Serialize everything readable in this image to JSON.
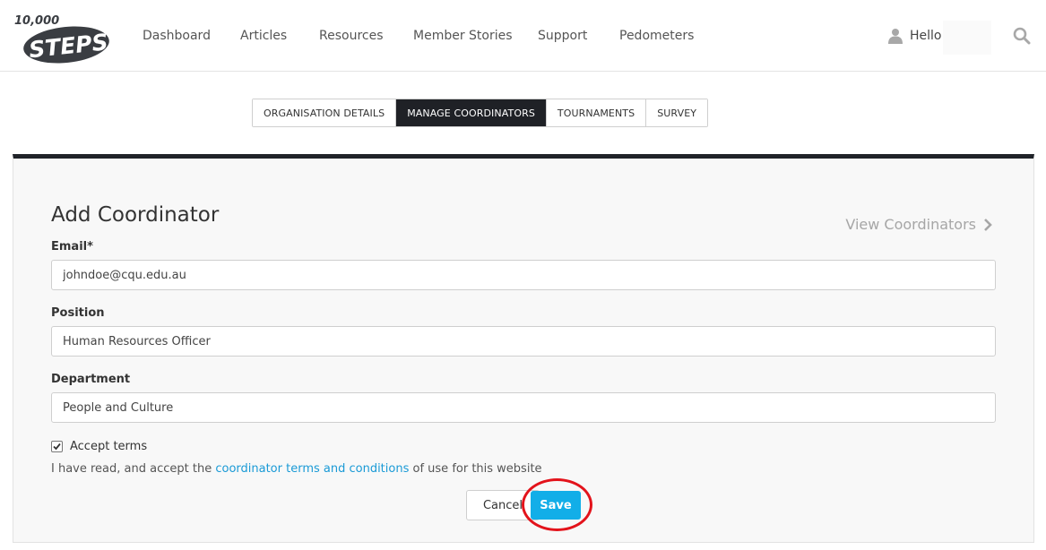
{
  "header": {
    "logo": {
      "top_text": "10,000",
      "main_text": "STEPS"
    },
    "nav": [
      "Dashboard",
      "Articles",
      "Resources",
      "Member Stories",
      "Support",
      "Pedometers"
    ],
    "user_greeting": "Hello",
    "icons": {
      "user": "user-icon",
      "search": "search-icon"
    }
  },
  "tabs": [
    {
      "label": "ORGANISATION DETAILS",
      "active": false
    },
    {
      "label": "MANAGE COORDINATORS",
      "active": true
    },
    {
      "label": "TOURNAMENTS",
      "active": false
    },
    {
      "label": "SURVEY",
      "active": false
    }
  ],
  "form": {
    "title": "Add Coordinator",
    "view_link": "View Coordinators",
    "email": {
      "label": "Email*",
      "value": "johndoe@cqu.edu.au"
    },
    "position": {
      "label": "Position",
      "value": "Human Resources Officer"
    },
    "department": {
      "label": "Department",
      "value": "People and Culture"
    },
    "accept": {
      "label": "Accept terms",
      "checked": true
    },
    "terms": {
      "prefix": "I have read, and accept the ",
      "link": "coordinator terms and conditions",
      "suffix": " of use for this website"
    },
    "cancel_label": "Cancel",
    "save_label": "Save"
  },
  "colors": {
    "accent": "#12aee8",
    "dark": "#1f2126",
    "highlight": "#e3131b",
    "link": "#1a9ad6"
  }
}
